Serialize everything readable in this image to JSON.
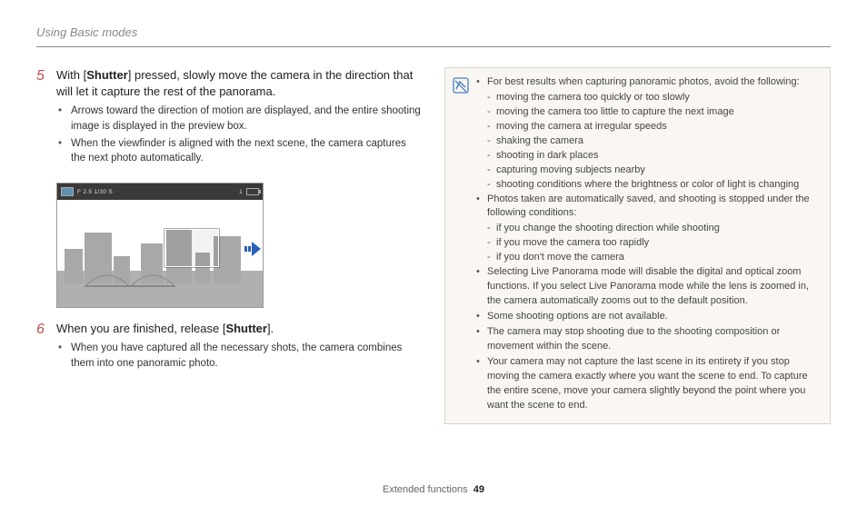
{
  "header": "Using Basic modes",
  "steps": [
    {
      "num": "5",
      "text_parts": [
        "With [",
        "Shutter",
        "] pressed, slowly move the camera in the direction that will let it capture the rest of the panorama."
      ],
      "subs": [
        "Arrows toward the direction of motion are displayed, and the entire shooting image is displayed in the preview box.",
        "When the viewfinder is aligned with the next scene, the camera captures the next photo automatically."
      ]
    },
    {
      "num": "6",
      "text_parts": [
        "When you are finished, release [",
        "Shutter",
        "]."
      ],
      "subs": [
        "When you have captured all the necessary shots, the camera combines them into one panoramic photo."
      ]
    }
  ],
  "preview_info": "F 2.5 1/30 S",
  "preview_count": "1",
  "note": {
    "items": [
      {
        "lvl": 1,
        "text": "For best results when capturing panoramic photos, avoid the following:"
      },
      {
        "lvl": 2,
        "text": "moving the camera too quickly or too slowly"
      },
      {
        "lvl": 2,
        "text": "moving the camera too little to capture the next image"
      },
      {
        "lvl": 2,
        "text": "moving the camera at irregular speeds"
      },
      {
        "lvl": 2,
        "text": "shaking the camera"
      },
      {
        "lvl": 2,
        "text": "shooting in dark places"
      },
      {
        "lvl": 2,
        "text": "capturing moving subjects nearby"
      },
      {
        "lvl": 2,
        "text": "shooting conditions where the brightness or color of light is changing"
      },
      {
        "lvl": 1,
        "text": "Photos taken are automatically saved, and shooting is stopped under the following conditions:"
      },
      {
        "lvl": 2,
        "text": "if you change the shooting direction while shooting"
      },
      {
        "lvl": 2,
        "text": "if you move the camera too rapidly"
      },
      {
        "lvl": 2,
        "text": "if you don't move the camera"
      },
      {
        "lvl": 1,
        "text": "Selecting Live Panorama mode will disable the digital and optical zoom functions. If you select Live Panorama mode while the lens is zoomed in, the camera automatically zooms out to the default position."
      },
      {
        "lvl": 1,
        "text": "Some shooting options are not available."
      },
      {
        "lvl": 1,
        "text": "The camera may stop shooting due to the shooting composition or movement within the scene."
      },
      {
        "lvl": 1,
        "text": "Your camera may not capture the last scene in its entirety if you stop moving the camera exactly where you want the scene to end. To capture the entire scene, move your camera slightly beyond the point where you want the scene to end."
      }
    ]
  },
  "footer": {
    "section": "Extended functions",
    "page": "49"
  }
}
